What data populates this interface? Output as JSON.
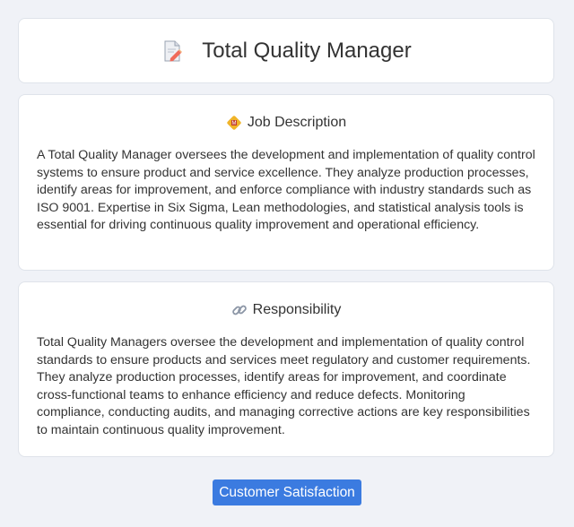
{
  "header": {
    "title": "Total Quality Manager",
    "icon": "document-pencil-icon"
  },
  "job_description": {
    "heading": "Job Description",
    "icon": "badge-icon",
    "body": "A Total Quality Manager oversees the development and implementation of quality control systems to ensure product and service excellence. They analyze production processes, identify areas for improvement, and enforce compliance with industry standards such as ISO 9001. Expertise in Six Sigma, Lean methodologies, and statistical analysis tools is essential for driving continuous quality improvement and operational efficiency."
  },
  "responsibility": {
    "heading": "Responsibility",
    "icon": "link-icon",
    "body": "Total Quality Managers oversee the development and implementation of quality control standards to ensure products and services meet regulatory and customer requirements. They analyze production processes, identify areas for improvement, and coordinate cross-functional teams to enhance efficiency and reduce defects. Monitoring compliance, conducting audits, and managing corrective actions are key responsibilities to maintain continuous quality improvement."
  },
  "tags": [
    {
      "label": "Customer Satisfaction"
    }
  ],
  "colors": {
    "background": "#f0f2f7",
    "tag": "#3b7be0"
  }
}
